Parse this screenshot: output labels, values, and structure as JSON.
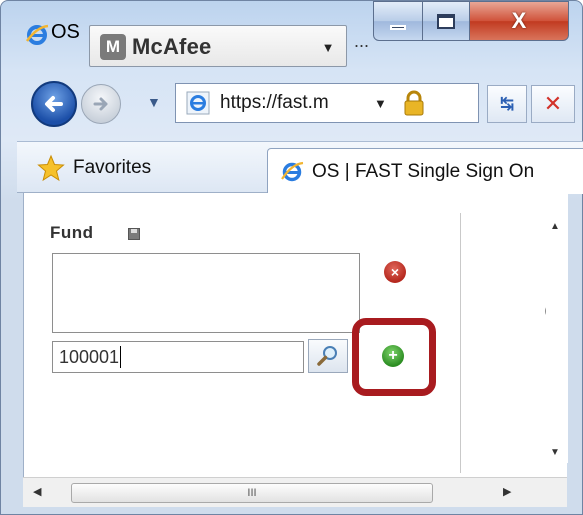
{
  "window": {
    "title_fragment": "OS",
    "title_overflow": "...",
    "caption": {
      "minimize_icon": "minimize-icon",
      "maximize_icon": "maximize-icon",
      "close_icon": "close-icon",
      "close_glyph": "X"
    }
  },
  "toolbar": {
    "mcafee_label": "McAfee",
    "mcafee_badge": "M",
    "dropdown_glyph": "▼"
  },
  "nav": {
    "address": "https://fast.m",
    "address_dropdown": "▼",
    "history_glyph": "▼",
    "refresh_glyph": "↹",
    "stop_glyph": "✕"
  },
  "favorites": {
    "label": "Favorites"
  },
  "tab": {
    "label": "OS | FAST Single Sign On"
  },
  "form": {
    "field_title": "Fund",
    "input_value": "100001",
    "remove_glyph": "×",
    "add_glyph": "+"
  },
  "side": {
    "glyph": "(≡)"
  },
  "scroll": {
    "thumb_grip": "III",
    "up_glyph": "▲",
    "down_glyph": "▼",
    "left_glyph": "◀",
    "right_glyph": "▶"
  },
  "colors": {
    "highlight": "#a81b1f",
    "add_green": "#2c8d22",
    "remove_red": "#b5281e",
    "close_red": "#c13a20"
  }
}
